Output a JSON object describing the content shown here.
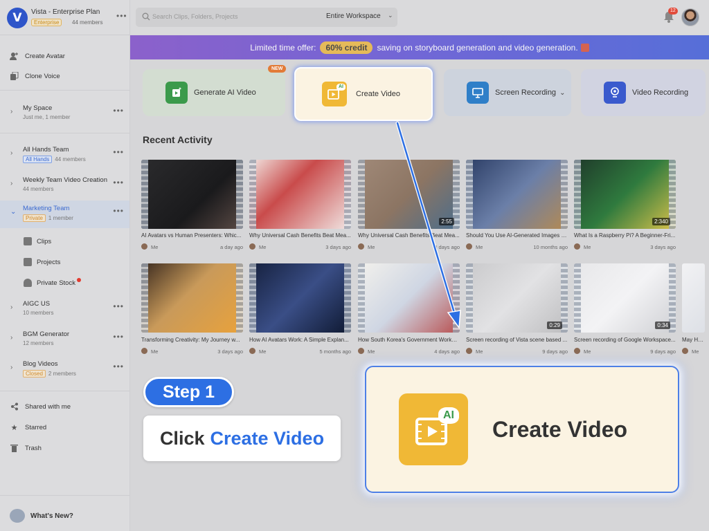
{
  "workspace": {
    "name": "Vista - Enterprise Plan",
    "plan_badge": "Enterprise",
    "members": "44 members",
    "logo_letter": "V"
  },
  "sidebar": {
    "top_actions": [
      {
        "label": "Create Avatar",
        "icon": "avatar-plus-icon"
      },
      {
        "label": "Clone Voice",
        "icon": "voice-clone-icon"
      }
    ],
    "spaces": [
      {
        "title": "My Space",
        "sub": "Just me, 1 member",
        "tag": ""
      },
      {
        "title": "All Hands Team",
        "sub": "44 members",
        "tag": "All Hands"
      },
      {
        "title": "Weekly Team Video Creation",
        "sub": "44 members",
        "tag": ""
      },
      {
        "title": "Marketing Team",
        "sub": "1 member",
        "tag": "Private"
      },
      {
        "title": "AIGC US",
        "sub": "10 members",
        "tag": ""
      },
      {
        "title": "BGM Generator",
        "sub": "12 members",
        "tag": ""
      },
      {
        "title": "Blog Videos",
        "sub": "2 members",
        "tag": "Closed"
      }
    ],
    "marketing_children": [
      {
        "label": "Clips",
        "icon": "clips-icon"
      },
      {
        "label": "Projects",
        "icon": "projects-icon"
      },
      {
        "label": "Private Stock",
        "icon": "private-stock-icon"
      }
    ],
    "bottom_links": [
      {
        "label": "Shared with me",
        "icon": "share-icon"
      },
      {
        "label": "Starred",
        "icon": "star-icon"
      },
      {
        "label": "Trash",
        "icon": "trash-icon"
      }
    ],
    "whats_new": "What's New?"
  },
  "topbar": {
    "search_placeholder": "Search Clips, Folders, Projects",
    "scope": "Entire Workspace",
    "notification_count": "12"
  },
  "promo": {
    "prefix": "Limited time offer:",
    "highlight": "60% credit",
    "suffix": "saving on storyboard generation and video generation."
  },
  "actions": {
    "generate_ai_video": "Generate AI Video",
    "new_badge": "NEW",
    "create_video": "Create Video",
    "screen_recording": "Screen Recording",
    "video_recording": "Video Recording",
    "ai_tag": "AI"
  },
  "recent": {
    "title": "Recent Activity",
    "row1": [
      {
        "title": "AI Avatars vs Human Presenters: Whic...",
        "by": "Me",
        "ago": "a day ago",
        "dur": ""
      },
      {
        "title": "Why Universal Cash Benefits Beat Mea...",
        "by": "Me",
        "ago": "3 days ago",
        "dur": ""
      },
      {
        "title": "Why Universal Cash Benefits Beat Mea...",
        "by": "Me",
        "ago": "3 days ago",
        "dur": "2:55"
      },
      {
        "title": "Should You Use AI-Generated Images a...",
        "by": "Me",
        "ago": "10 months ago",
        "dur": ""
      },
      {
        "title": "What Is a Raspberry Pi? A Beginner-Fri...",
        "by": "Me",
        "ago": "3 days ago",
        "dur": "2:340"
      }
    ],
    "row2": [
      {
        "title": "Transforming Creativity: My Journey w...",
        "by": "Me",
        "ago": "3 days ago",
        "dur": ""
      },
      {
        "title": "How AI Avatars Work: A Simple Explan...",
        "by": "Me",
        "ago": "5 months ago",
        "dur": ""
      },
      {
        "title": "How South Korea's Government Works:...",
        "by": "Me",
        "ago": "4 days ago",
        "dur": ""
      },
      {
        "title": "Screen recording of Vista scene based ...",
        "by": "Me",
        "ago": "9 days ago",
        "dur": "0:29"
      },
      {
        "title": "Screen recording of Google Workspace...",
        "by": "Me",
        "ago": "9 days ago",
        "dur": "0:34"
      },
      {
        "title": "May Horiuch",
        "by": "Me",
        "ago": "",
        "dur": ""
      }
    ]
  },
  "tutorial": {
    "step": "Step 1",
    "instruction_prefix": "Click",
    "instruction_highlight": "Create Video",
    "callout_label": "Create Video"
  },
  "colors": {
    "accent": "#2d6fe3",
    "brand": "#2e55c9",
    "ai_icon": "#f0b836",
    "promo_pill": "#e9b43e"
  }
}
